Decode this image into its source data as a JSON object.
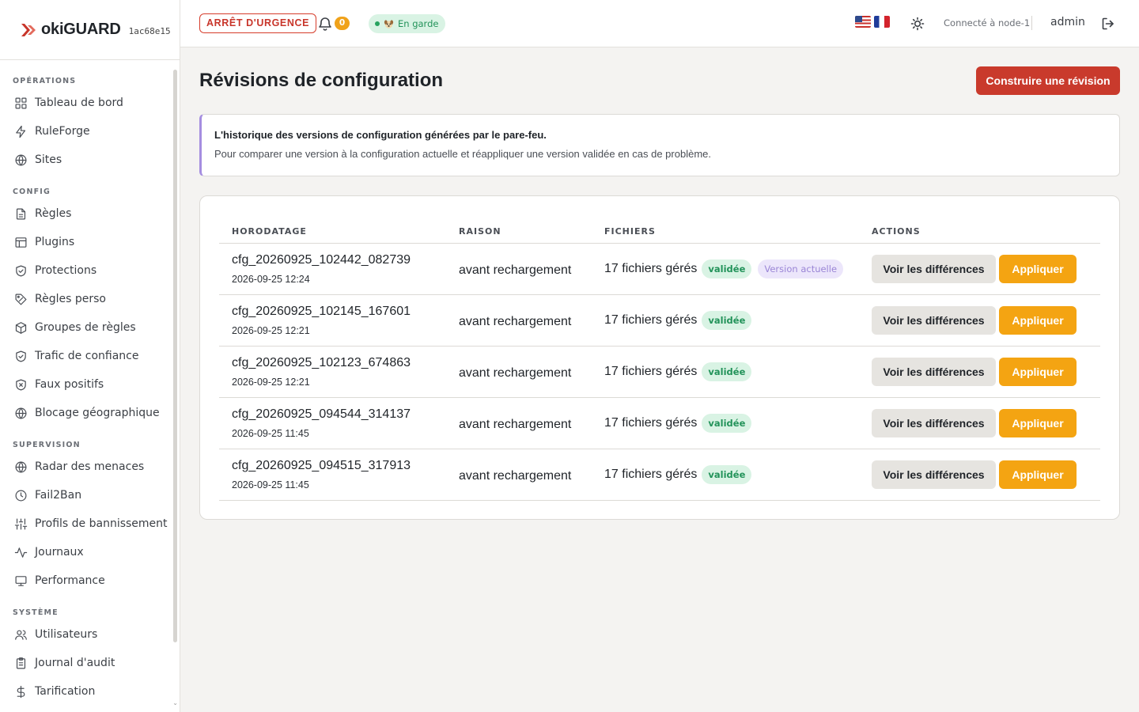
{
  "brand": {
    "name": "okiGUARD",
    "id": "1ac68e15",
    "logo_icon": "okiguard-logo-icon"
  },
  "sidebar": {
    "sections": [
      {
        "title": "OPÉRATIONS",
        "items": [
          {
            "label": "Tableau de bord",
            "icon": "grid-icon"
          },
          {
            "label": "RuleForge",
            "icon": "bolt-icon"
          },
          {
            "label": "Sites",
            "icon": "globe-icon"
          }
        ]
      },
      {
        "title": "CONFIG",
        "items": [
          {
            "label": "Règles",
            "icon": "document-icon"
          },
          {
            "label": "Plugins",
            "icon": "layout-icon"
          },
          {
            "label": "Protections",
            "icon": "shield-check-icon"
          },
          {
            "label": "Règles perso",
            "icon": "tag-icon"
          },
          {
            "label": "Groupes de règles",
            "icon": "box-icon"
          },
          {
            "label": "Trafic de confiance",
            "icon": "shield-check-icon"
          },
          {
            "label": "Faux positifs",
            "icon": "shield-x-icon"
          },
          {
            "label": "Blocage géographique",
            "icon": "globe-icon"
          }
        ]
      },
      {
        "title": "SUPERVISION",
        "items": [
          {
            "label": "Radar des menaces",
            "icon": "globe-icon"
          },
          {
            "label": "Fail2Ban",
            "icon": "clock-icon"
          },
          {
            "label": "Profils de bannissement",
            "icon": "sliders-icon"
          },
          {
            "label": "Journaux",
            "icon": "activity-icon"
          },
          {
            "label": "Performance",
            "icon": "monitor-icon"
          }
        ]
      },
      {
        "title": "SYSTÈME",
        "items": [
          {
            "label": "Utilisateurs",
            "icon": "users-icon"
          },
          {
            "label": "Journal d'audit",
            "icon": "clipboard-icon"
          },
          {
            "label": "Tarification",
            "icon": "dollar-icon"
          }
        ]
      }
    ]
  },
  "header": {
    "emergency_label": "ARRÊT D'URGENCE",
    "notifications_count": "0",
    "guard_status": "En garde",
    "connected_label": "Connecté à node-1",
    "user": "admin"
  },
  "main": {
    "title": "Révisions de configuration",
    "build_button": "Construire une révision",
    "info": {
      "title": "L'historique des versions de configuration générées par le pare-feu.",
      "description": "Pour comparer une version à la configuration actuelle et réappliquer une version validée en cas de problème."
    },
    "table": {
      "headers": [
        "HORODATAGE",
        "RAISON",
        "FICHIERS",
        "ACTIONS"
      ],
      "rows": [
        {
          "name": "cfg_20260925_102442_082739",
          "time": "2026-09-25 12:24",
          "reason": "avant rechargement",
          "files": "17 fichiers gérés",
          "status": "validée",
          "current": "Version actuelle"
        },
        {
          "name": "cfg_20260925_102145_167601",
          "time": "2026-09-25 12:21",
          "reason": "avant rechargement",
          "files": "17 fichiers gérés",
          "status": "validée",
          "current": ""
        },
        {
          "name": "cfg_20260925_102123_674863",
          "time": "2026-09-25 12:21",
          "reason": "avant rechargement",
          "files": "17 fichiers gérés",
          "status": "validée",
          "current": ""
        },
        {
          "name": "cfg_20260925_094544_314137",
          "time": "2026-09-25 11:45",
          "reason": "avant rechargement",
          "files": "17 fichiers gérés",
          "status": "validée",
          "current": ""
        },
        {
          "name": "cfg_20260925_094515_317913",
          "time": "2026-09-25 11:45",
          "reason": "avant rechargement",
          "files": "17 fichiers gérés",
          "status": "validée",
          "current": ""
        }
      ],
      "diff_label": "Voir les différences",
      "apply_label": "Appliquer"
    }
  },
  "colors": {
    "accent": "#c93a2c",
    "apply": "#f4a412",
    "success": "#23935a",
    "info_border": "#a58ee0"
  }
}
